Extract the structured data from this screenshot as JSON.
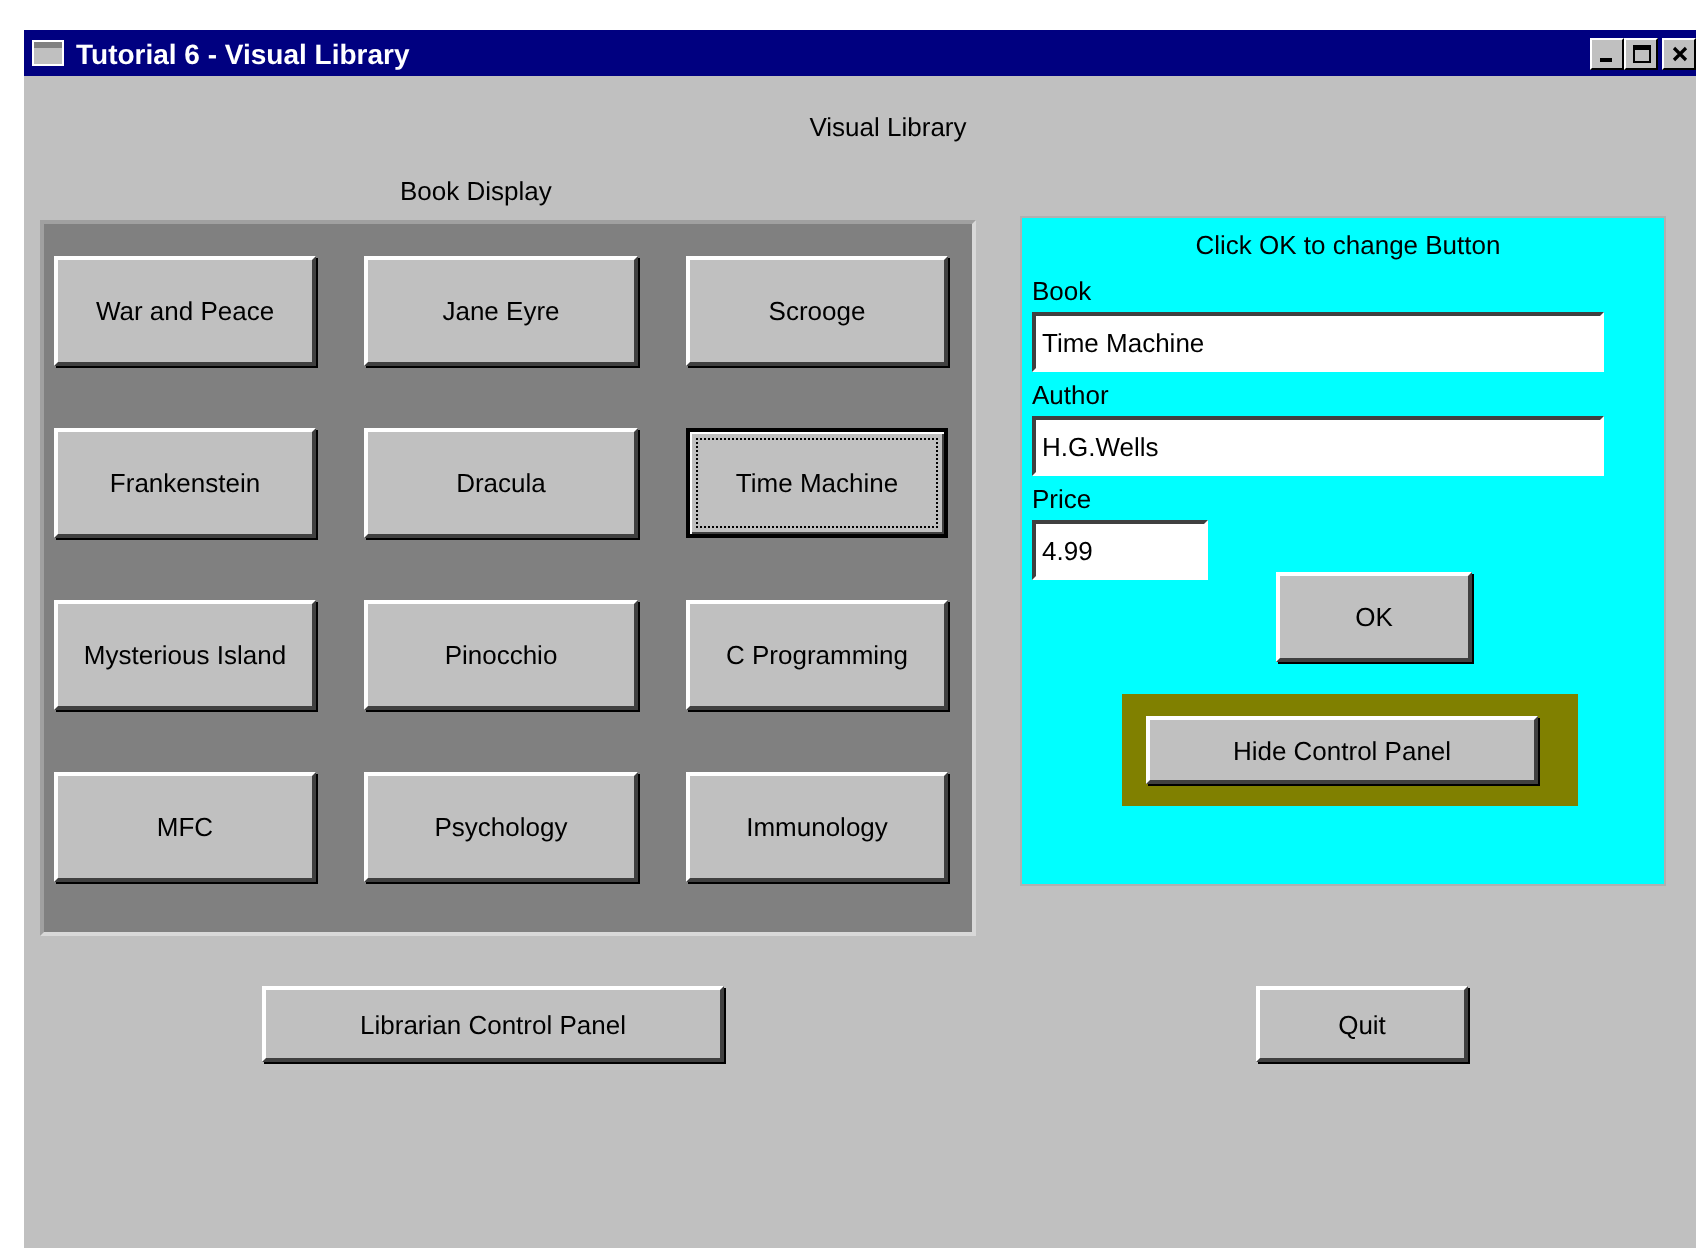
{
  "window": {
    "title": "Tutorial 6 - Visual Library"
  },
  "heading": "Visual Library",
  "book_display": {
    "label": "Book Display",
    "books": [
      {
        "label": "War and Peace",
        "selected": false
      },
      {
        "label": "Jane Eyre",
        "selected": false
      },
      {
        "label": "Scrooge",
        "selected": false
      },
      {
        "label": "Frankenstein",
        "selected": false
      },
      {
        "label": "Dracula",
        "selected": false
      },
      {
        "label": "Time Machine",
        "selected": true
      },
      {
        "label": "Mysterious Island",
        "selected": false
      },
      {
        "label": "Pinocchio",
        "selected": false
      },
      {
        "label": "C Programming",
        "selected": false
      },
      {
        "label": "MFC",
        "selected": false
      },
      {
        "label": "Psychology",
        "selected": false
      },
      {
        "label": "Immunology",
        "selected": false
      }
    ]
  },
  "control_panel": {
    "instruction": "Click OK to change Button",
    "fields": [
      {
        "label": "Book",
        "value": "Time Machine",
        "kind": "wide"
      },
      {
        "label": "Author",
        "value": "H.G.Wells",
        "kind": "wide"
      },
      {
        "label": "Price",
        "value": "4.99",
        "kind": "short"
      }
    ],
    "ok_button": "OK",
    "hide_button": "Hide Control Panel"
  },
  "buttons": [
    "Librarian Control Panel",
    "Quit"
  ]
}
